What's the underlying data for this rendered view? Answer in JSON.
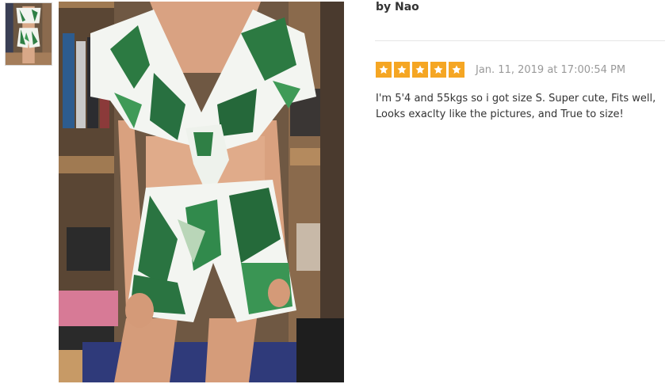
{
  "review": {
    "author": "by Nao",
    "rating": 5,
    "rating_max": 5,
    "date": "Jan. 11, 2019 at 17:00:54 PM",
    "text": "I'm 5'4 and 55kgs so i got size S. Super cute, Fits well, Looks exaclty like the pictures, and True to size!"
  },
  "colors": {
    "star": "#f5a623",
    "author_text": "#333333",
    "date_text": "#999999",
    "body_text": "#333333",
    "divider": "#e6e6e6"
  },
  "icons": {
    "star": "star-icon"
  }
}
